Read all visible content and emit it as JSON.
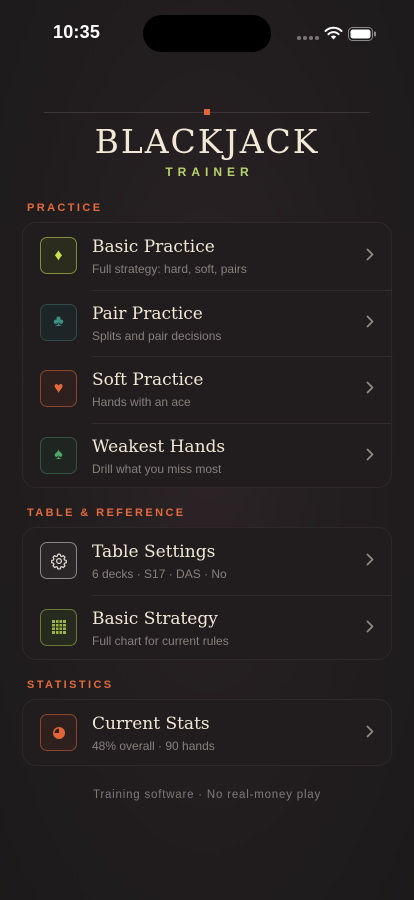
{
  "status_bar": {
    "time": "10:35"
  },
  "brand": {
    "title": "BLACKJACK",
    "subtitle": "TRAINER"
  },
  "sections": {
    "practice": {
      "label": "PRACTICE",
      "items": [
        {
          "title": "Basic Practice",
          "subtitle": "Full strategy: hard, soft, pairs",
          "icon": "diamond-icon",
          "glyph": "♦",
          "color": "#c6e34e"
        },
        {
          "title": "Pair Practice",
          "subtitle": "Splits and pair decisions",
          "icon": "club-icon",
          "glyph": "♣",
          "color": "#3f8f84"
        },
        {
          "title": "Soft Practice",
          "subtitle": "Hands with an ace",
          "icon": "heart-icon",
          "glyph": "♥",
          "color": "#e86a3a"
        },
        {
          "title": "Weakest Hands",
          "subtitle": "Drill what you miss most",
          "icon": "spade-icon",
          "glyph": "♠",
          "color": "#4fa86a"
        }
      ]
    },
    "table": {
      "label": "TABLE & REFERENCE",
      "items": [
        {
          "title": "Table Settings",
          "subtitle": "6 decks · S17 · DAS · No",
          "icon": "gear-icon",
          "color": "#d8d2cc"
        },
        {
          "title": "Basic Strategy",
          "subtitle": "Full chart for current rules",
          "icon": "grid-icon",
          "color": "#9ab640"
        }
      ]
    },
    "stats": {
      "label": "STATISTICS",
      "items": [
        {
          "title": "Current Stats",
          "subtitle": "48% overall · 90 hands",
          "icon": "pie-chart-icon",
          "color": "#e0663a"
        }
      ]
    }
  },
  "footer": "Training software · No real-money play",
  "colors": {
    "accent": "#e26a3c",
    "brand_sub": "#b7d36a"
  }
}
